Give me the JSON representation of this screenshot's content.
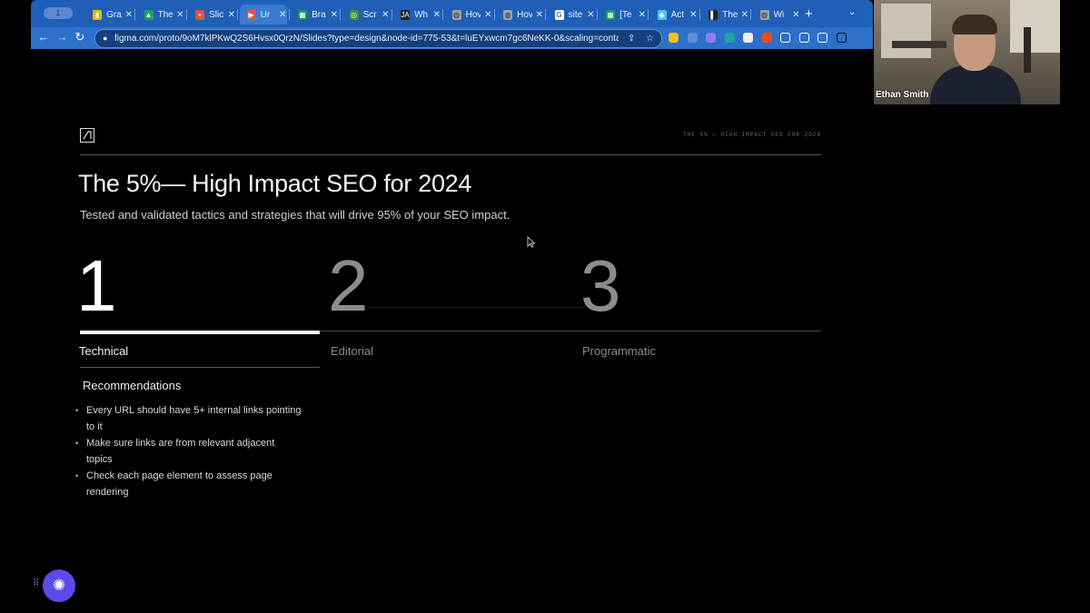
{
  "browser": {
    "tabs": [
      {
        "title": "Gra",
        "color": "#f4b400",
        "glyph": "▮"
      },
      {
        "title": "The",
        "color": "#1fa463",
        "glyph": "▲"
      },
      {
        "title": "Slic",
        "color": "#e8533b",
        "glyph": "▪"
      },
      {
        "title": "Ur",
        "color": "#e8533b",
        "glyph": "▶"
      },
      {
        "title": "Bra",
        "color": "#0f9d58",
        "glyph": "▦"
      },
      {
        "title": "Scr",
        "color": "#3c8f3c",
        "glyph": "◎"
      },
      {
        "title": "Wh",
        "color": "#222222",
        "glyph": "JA"
      },
      {
        "title": "Hov",
        "color": "#9aa0a6",
        "glyph": "◍"
      },
      {
        "title": "Hov",
        "color": "#9aa0a6",
        "glyph": "◍"
      },
      {
        "title": "site",
        "color": "#ffffff",
        "glyph": "G"
      },
      {
        "title": "[Te",
        "color": "#0f9d58",
        "glyph": "▦"
      },
      {
        "title": "Act",
        "color": "#4fc3f7",
        "glyph": "◆"
      },
      {
        "title": "The",
        "color": "#222222",
        "glyph": "▌"
      },
      {
        "title": "Wi",
        "color": "#9aa0a6",
        "glyph": "◍"
      }
    ],
    "pill_label": "1",
    "new_tab": "+",
    "tab_menu": "⌄",
    "nav": {
      "back": "←",
      "forward": "→",
      "reload": "↻"
    },
    "url": "figma.com/proto/9oM7klPKwQ2S6Hvsx0QrzN/Slides?type=design&node-id=775-53&t=luEYxwcm7gc6NeKK-0&scaling=contain&...",
    "omnibox_icons": {
      "share": "⇪",
      "star": "☆"
    },
    "extensions": [
      "#f4c20d",
      "#5f8dd3",
      "#8e7cf2",
      "#1fa2a0",
      "#e9eef7",
      "#f24e1e",
      "#ffffff",
      "#ffffff",
      "#ffffff",
      "#111111"
    ]
  },
  "slide": {
    "header_tag": "THE 5% — HIGH IMPACT SEO FOR 2024",
    "title": "The 5%— High Impact SEO for 2024",
    "subtitle": "Tested and validated tactics and strategies that will drive 95% of your SEO impact.",
    "pillars": [
      {
        "number": "1",
        "label": "Technical",
        "active": true
      },
      {
        "number": "2",
        "label": "Editorial",
        "active": false
      },
      {
        "number": "3",
        "label": "Programmatic",
        "active": false
      }
    ],
    "recommendations_heading": "Recommendations",
    "recommendations": [
      "Every URL should have 5+ internal links pointing to it",
      "Make sure links are from relevant adjacent topics",
      "Check each page element to assess page rendering"
    ]
  },
  "video": {
    "participant_name": "Ethan Smith"
  },
  "widget": {
    "glyph": "✺",
    "grip": "⠿"
  }
}
